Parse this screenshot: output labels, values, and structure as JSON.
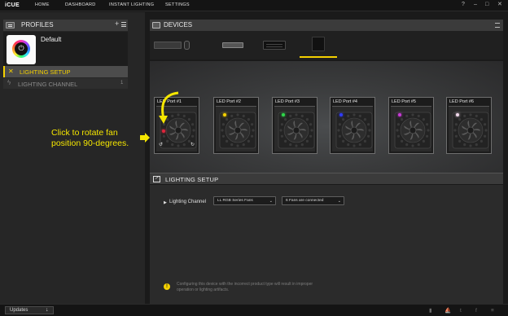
{
  "app": {
    "brand": "iCUE"
  },
  "nav": {
    "home": "HOME",
    "dashboard": "DASHBOARD",
    "instant_lighting": "INSTANT LIGHTING",
    "settings": "SETTINGS"
  },
  "window_controls": {
    "help": "?",
    "minimize": "–",
    "maximize": "□",
    "close": "✕"
  },
  "profiles": {
    "title": "PROFILES",
    "add": "+",
    "profile_name": "Default",
    "menu": [
      {
        "label": "LIGHTING SETUP",
        "active": true
      },
      {
        "label": "LIGHTING CHANNEL",
        "count": "1",
        "active": false
      }
    ]
  },
  "tooltip": {
    "text": "Click to rotate fan position 90-degrees."
  },
  "devices": {
    "title": "DEVICES",
    "items": [
      "keyboard-and-mouse",
      "memory-module",
      "lighting-node",
      "commander-controller"
    ],
    "selected_index": 3
  },
  "fan_ports": [
    {
      "label": "LED Port #1",
      "led_color": "#e0243c"
    },
    {
      "label": "LED Port #2",
      "led_color": "#f5d100"
    },
    {
      "label": "LED Port #3",
      "led_color": "#2fd84a"
    },
    {
      "label": "LED Port #4",
      "led_color": "#2f3cff"
    },
    {
      "label": "LED Port #5",
      "led_color": "#c93cd8"
    },
    {
      "label": "LED Port #6",
      "led_color": "#f0d8ea"
    }
  ],
  "lighting_setup": {
    "title": "LIGHTING SETUP",
    "channel_label": "Lighting Channel",
    "product_select": "LL RGB Series Fans",
    "count_select": "6 Fans are connected",
    "warning": "Configuring this device with the incorrect product type will result in improper operation or lighting artifacts."
  },
  "status": {
    "updates": "Updates"
  },
  "colors": {
    "accent": "#f5d100",
    "background": "#1a1a1a",
    "panel": "#3b3b3b"
  }
}
